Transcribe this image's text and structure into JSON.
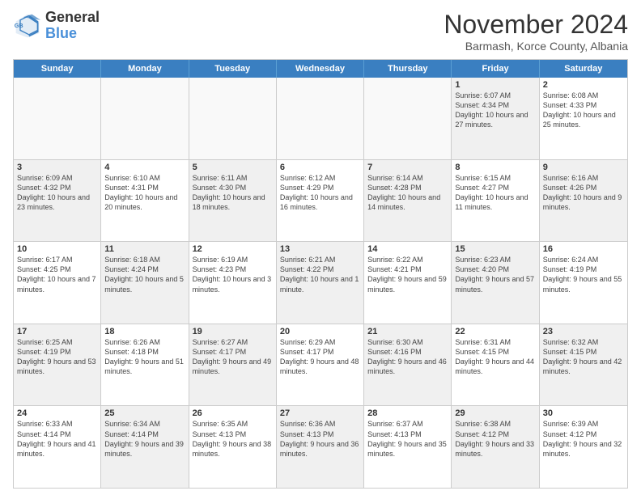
{
  "header": {
    "logo": {
      "line1": "General",
      "line2": "Blue"
    },
    "title": "November 2024",
    "subtitle": "Barmash, Korce County, Albania"
  },
  "days_of_week": [
    "Sunday",
    "Monday",
    "Tuesday",
    "Wednesday",
    "Thursday",
    "Friday",
    "Saturday"
  ],
  "weeks": [
    {
      "cells": [
        {
          "day": "",
          "info": "",
          "empty": true
        },
        {
          "day": "",
          "info": "",
          "empty": true
        },
        {
          "day": "",
          "info": "",
          "empty": true
        },
        {
          "day": "",
          "info": "",
          "empty": true
        },
        {
          "day": "",
          "info": "",
          "empty": true
        },
        {
          "day": "1",
          "info": "Sunrise: 6:07 AM\nSunset: 4:34 PM\nDaylight: 10 hours and 27 minutes.",
          "shaded": true
        },
        {
          "day": "2",
          "info": "Sunrise: 6:08 AM\nSunset: 4:33 PM\nDaylight: 10 hours and 25 minutes.",
          "shaded": false
        }
      ]
    },
    {
      "cells": [
        {
          "day": "3",
          "info": "Sunrise: 6:09 AM\nSunset: 4:32 PM\nDaylight: 10 hours and 23 minutes.",
          "shaded": true
        },
        {
          "day": "4",
          "info": "Sunrise: 6:10 AM\nSunset: 4:31 PM\nDaylight: 10 hours and 20 minutes.",
          "shaded": false
        },
        {
          "day": "5",
          "info": "Sunrise: 6:11 AM\nSunset: 4:30 PM\nDaylight: 10 hours and 18 minutes.",
          "shaded": true
        },
        {
          "day": "6",
          "info": "Sunrise: 6:12 AM\nSunset: 4:29 PM\nDaylight: 10 hours and 16 minutes.",
          "shaded": false
        },
        {
          "day": "7",
          "info": "Sunrise: 6:14 AM\nSunset: 4:28 PM\nDaylight: 10 hours and 14 minutes.",
          "shaded": true
        },
        {
          "day": "8",
          "info": "Sunrise: 6:15 AM\nSunset: 4:27 PM\nDaylight: 10 hours and 11 minutes.",
          "shaded": false
        },
        {
          "day": "9",
          "info": "Sunrise: 6:16 AM\nSunset: 4:26 PM\nDaylight: 10 hours and 9 minutes.",
          "shaded": true
        }
      ]
    },
    {
      "cells": [
        {
          "day": "10",
          "info": "Sunrise: 6:17 AM\nSunset: 4:25 PM\nDaylight: 10 hours and 7 minutes.",
          "shaded": false
        },
        {
          "day": "11",
          "info": "Sunrise: 6:18 AM\nSunset: 4:24 PM\nDaylight: 10 hours and 5 minutes.",
          "shaded": true
        },
        {
          "day": "12",
          "info": "Sunrise: 6:19 AM\nSunset: 4:23 PM\nDaylight: 10 hours and 3 minutes.",
          "shaded": false
        },
        {
          "day": "13",
          "info": "Sunrise: 6:21 AM\nSunset: 4:22 PM\nDaylight: 10 hours and 1 minute.",
          "shaded": true
        },
        {
          "day": "14",
          "info": "Sunrise: 6:22 AM\nSunset: 4:21 PM\nDaylight: 9 hours and 59 minutes.",
          "shaded": false
        },
        {
          "day": "15",
          "info": "Sunrise: 6:23 AM\nSunset: 4:20 PM\nDaylight: 9 hours and 57 minutes.",
          "shaded": true
        },
        {
          "day": "16",
          "info": "Sunrise: 6:24 AM\nSunset: 4:19 PM\nDaylight: 9 hours and 55 minutes.",
          "shaded": false
        }
      ]
    },
    {
      "cells": [
        {
          "day": "17",
          "info": "Sunrise: 6:25 AM\nSunset: 4:19 PM\nDaylight: 9 hours and 53 minutes.",
          "shaded": true
        },
        {
          "day": "18",
          "info": "Sunrise: 6:26 AM\nSunset: 4:18 PM\nDaylight: 9 hours and 51 minutes.",
          "shaded": false
        },
        {
          "day": "19",
          "info": "Sunrise: 6:27 AM\nSunset: 4:17 PM\nDaylight: 9 hours and 49 minutes.",
          "shaded": true
        },
        {
          "day": "20",
          "info": "Sunrise: 6:29 AM\nSunset: 4:17 PM\nDaylight: 9 hours and 48 minutes.",
          "shaded": false
        },
        {
          "day": "21",
          "info": "Sunrise: 6:30 AM\nSunset: 4:16 PM\nDaylight: 9 hours and 46 minutes.",
          "shaded": true
        },
        {
          "day": "22",
          "info": "Sunrise: 6:31 AM\nSunset: 4:15 PM\nDaylight: 9 hours and 44 minutes.",
          "shaded": false
        },
        {
          "day": "23",
          "info": "Sunrise: 6:32 AM\nSunset: 4:15 PM\nDaylight: 9 hours and 42 minutes.",
          "shaded": true
        }
      ]
    },
    {
      "cells": [
        {
          "day": "24",
          "info": "Sunrise: 6:33 AM\nSunset: 4:14 PM\nDaylight: 9 hours and 41 minutes.",
          "shaded": false
        },
        {
          "day": "25",
          "info": "Sunrise: 6:34 AM\nSunset: 4:14 PM\nDaylight: 9 hours and 39 minutes.",
          "shaded": true
        },
        {
          "day": "26",
          "info": "Sunrise: 6:35 AM\nSunset: 4:13 PM\nDaylight: 9 hours and 38 minutes.",
          "shaded": false
        },
        {
          "day": "27",
          "info": "Sunrise: 6:36 AM\nSunset: 4:13 PM\nDaylight: 9 hours and 36 minutes.",
          "shaded": true
        },
        {
          "day": "28",
          "info": "Sunrise: 6:37 AM\nSunset: 4:13 PM\nDaylight: 9 hours and 35 minutes.",
          "shaded": false
        },
        {
          "day": "29",
          "info": "Sunrise: 6:38 AM\nSunset: 4:12 PM\nDaylight: 9 hours and 33 minutes.",
          "shaded": true
        },
        {
          "day": "30",
          "info": "Sunrise: 6:39 AM\nSunset: 4:12 PM\nDaylight: 9 hours and 32 minutes.",
          "shaded": false
        }
      ]
    }
  ]
}
